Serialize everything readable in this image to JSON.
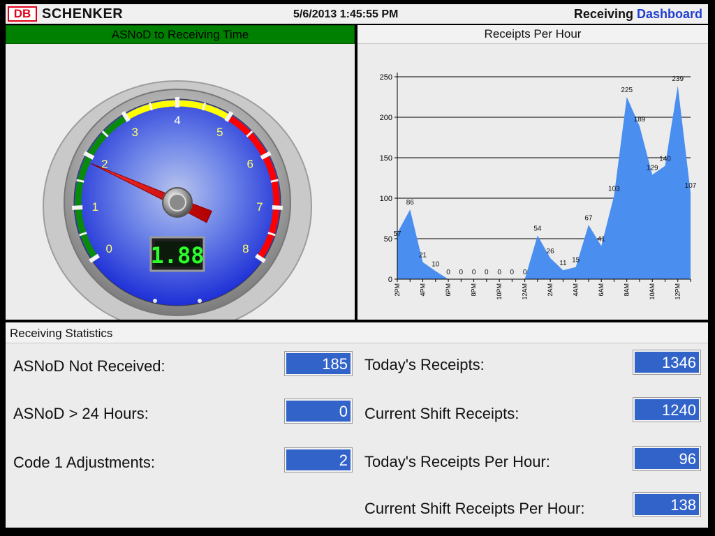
{
  "header": {
    "logo_text": "DB",
    "brand": "SCHENKER",
    "datetime": "5/6/2013 1:45:55 PM",
    "title_part1": "Receiving",
    "title_part2": "Dashboard"
  },
  "gauge": {
    "title": "ASNoD to Receiving Time",
    "display": "1.88",
    "value": 1.88,
    "min": 0,
    "max": 8,
    "scale_labels": [
      "0",
      "1",
      "2",
      "3",
      "4",
      "5",
      "6",
      "7",
      "8"
    ],
    "bands": [
      {
        "from": 0,
        "to": 3,
        "color": "#0a8a0a"
      },
      {
        "from": 3,
        "to": 5,
        "color": "#ffff00"
      },
      {
        "from": 5,
        "to": 8,
        "color": "#ff0000"
      }
    ]
  },
  "chart_data": {
    "type": "area",
    "title": "Receipts Per Hour",
    "x": [
      "2PM",
      "3PM",
      "4PM",
      "5PM",
      "6PM",
      "7PM",
      "8PM",
      "9PM",
      "10PM",
      "11PM",
      "12AM",
      "1AM",
      "2AM",
      "3AM",
      "4AM",
      "5AM",
      "6AM",
      "7AM",
      "8AM",
      "9AM",
      "10AM",
      "11AM",
      "12PM",
      "1PM"
    ],
    "x_tick_labels": [
      "2PM",
      "4PM",
      "6PM",
      "8PM",
      "10PM",
      "12AM",
      "2AM",
      "4AM",
      "6AM",
      "8AM",
      "10AM",
      "12PM"
    ],
    "values": [
      57,
      86,
      21,
      10,
      0,
      0,
      0,
      0,
      0,
      0,
      0,
      54,
      26,
      11,
      15,
      67,
      41,
      103,
      225,
      189,
      129,
      140,
      239,
      107
    ],
    "y_ticks": [
      "0",
      "50",
      "100",
      "150",
      "200",
      "250"
    ],
    "ylim": [
      0,
      250
    ],
    "grid": true,
    "color": "#4a8ef0"
  },
  "stats": {
    "title": "Receiving Statistics",
    "items": [
      {
        "label": "ASNoD Not Received:",
        "value": "185"
      },
      {
        "label": "ASNoD > 24 Hours:",
        "value": "0"
      },
      {
        "label": "Code 1 Adjustments:",
        "value": "2"
      },
      {
        "label": "Today's Receipts:",
        "value": "1346"
      },
      {
        "label": "Current Shift Receipts:",
        "value": "1240"
      },
      {
        "label": "Today's Receipts Per Hour:",
        "value": "96"
      },
      {
        "label": "Current Shift Receipts Per Hour:",
        "value": "138"
      }
    ]
  }
}
